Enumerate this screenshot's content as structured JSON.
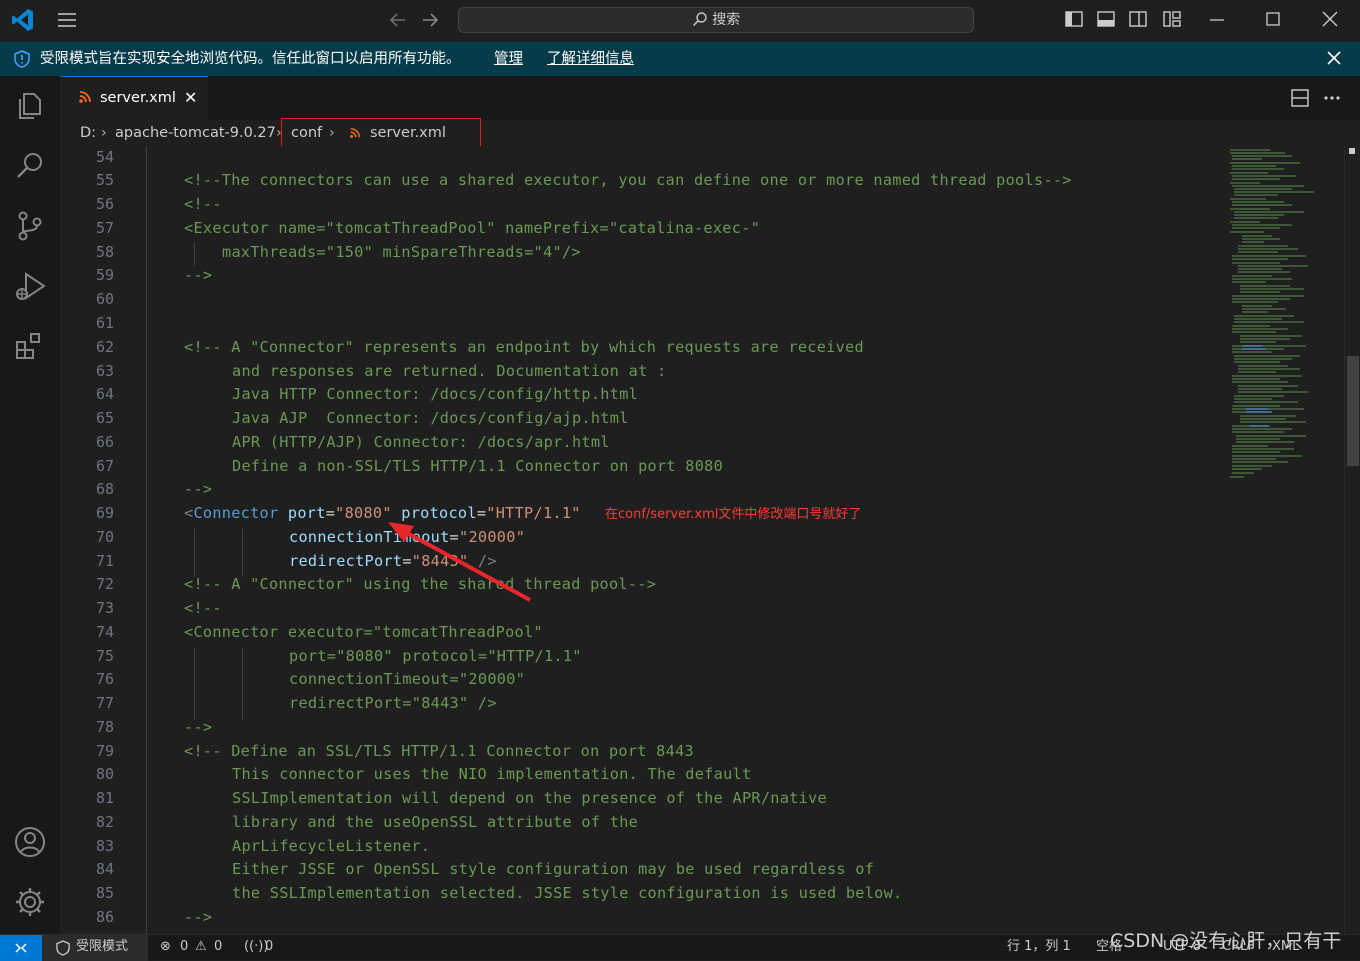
{
  "titlebar": {
    "menu_icon": "hamburger-icon",
    "search_label": "搜索",
    "layout_icons": [
      "toggle-primary-sidebar-icon",
      "toggle-panel-icon",
      "toggle-secondary-sidebar-icon",
      "customize-layout-icon"
    ],
    "window_controls": [
      "minimize-icon",
      "maximize-icon",
      "close-icon"
    ]
  },
  "banner": {
    "message": "受限模式旨在实现安全地浏览代码。信任此窗口以启用所有功能。",
    "manage": "管理",
    "learn_more": "了解详细信息"
  },
  "tab": {
    "file_name": "server.xml",
    "close": "✕"
  },
  "breadcrumbs": [
    "D:",
    "apache-tomcat-9.0.27",
    "conf",
    "server.xml"
  ],
  "editor": {
    "lines": [
      {
        "n": "54"
      },
      {
        "n": "55"
      },
      {
        "n": "56"
      },
      {
        "n": "57"
      },
      {
        "n": "58"
      },
      {
        "n": "59"
      },
      {
        "n": "60"
      },
      {
        "n": "61"
      },
      {
        "n": "62"
      },
      {
        "n": "63"
      },
      {
        "n": "64"
      },
      {
        "n": "65"
      },
      {
        "n": "66"
      },
      {
        "n": "67"
      },
      {
        "n": "68"
      },
      {
        "n": "69"
      },
      {
        "n": "70"
      },
      {
        "n": "71"
      },
      {
        "n": "72"
      },
      {
        "n": "73"
      },
      {
        "n": "74"
      },
      {
        "n": "75"
      },
      {
        "n": "76"
      },
      {
        "n": "77"
      },
      {
        "n": "78"
      },
      {
        "n": "79"
      },
      {
        "n": "80"
      },
      {
        "n": "81"
      },
      {
        "n": "82"
      },
      {
        "n": "83"
      },
      {
        "n": "84"
      },
      {
        "n": "85"
      },
      {
        "n": "86"
      }
    ],
    "code": {
      "l55": "<!--The connectors can use a shared executor, you can define one or more named thread pools-->",
      "l56": "<!--",
      "l57a": "<Executor name=\"tomcatThreadPool\" namePrefix=\"catalina-exec-\"",
      "l58": "maxThreads=\"150\" minSpareThreads=\"4\"/>",
      "l59": "-->",
      "l62": "<!-- A \"Connector\" represents an endpoint by which requests are received",
      "l63": "and responses are returned. Documentation at :",
      "l64": "Java HTTP Connector: /docs/config/http.html",
      "l65": "Java AJP  Connector: /docs/config/ajp.html",
      "l66": "APR (HTTP/AJP) Connector: /docs/apr.html",
      "l67": "Define a non-SSL/TLS HTTP/1.1 Connector on port 8080",
      "l68": "-->",
      "l69_tag": "Connector",
      "l69_a1": "port",
      "l69_v1": "\"8080\"",
      "l69_a2": "protocol",
      "l69_v2": "\"HTTP/1.1\"",
      "l70_a": "connectionTimeout",
      "l70_v": "\"20000\"",
      "l71_a": "redirectPort",
      "l71_v": "\"8443\"",
      "l72": "<!-- A \"Connector\" using the shared thread pool-->",
      "l73": "<!--",
      "l74": "<Connector executor=\"tomcatThreadPool\"",
      "l75": "port=\"8080\" protocol=\"HTTP/1.1\"",
      "l76": "connectionTimeout=\"20000\"",
      "l77": "redirectPort=\"8443\" />",
      "l78": "-->",
      "l79": "<!-- Define an SSL/TLS HTTP/1.1 Connector on port 8443",
      "l80": "This connector uses the NIO implementation. The default",
      "l81": "SSLImplementation will depend on the presence of the APR/native",
      "l82": "library and the useOpenSSL attribute of the",
      "l83": "AprLifecycleListener.",
      "l84": "Either JSSE or OpenSSL style configuration may be used regardless of",
      "l85": "the SSLImplementation selected. JSSE style configuration is used below.",
      "l86": "-->"
    },
    "annotation": "在conf/server.xml文件中修改端口号就好了"
  },
  "statusbar": {
    "remote_icon": "remote-icon",
    "restricted": "受限模式",
    "errors": "0",
    "warnings": "0",
    "ports": "0",
    "position": "行 1，列 1",
    "spaces": "空格",
    "encoding": "UTF-8",
    "eol": "CRLF",
    "language": "XML"
  },
  "watermark": "CSDN @没有心肝，只有干",
  "colors": {
    "accent": "#0078d4",
    "banner": "#063b49",
    "annotation": "#ff3b30",
    "comment": "#6a9955",
    "tag": "#569cd6",
    "attribute": "#9cdcfe",
    "string": "#ce9178"
  }
}
